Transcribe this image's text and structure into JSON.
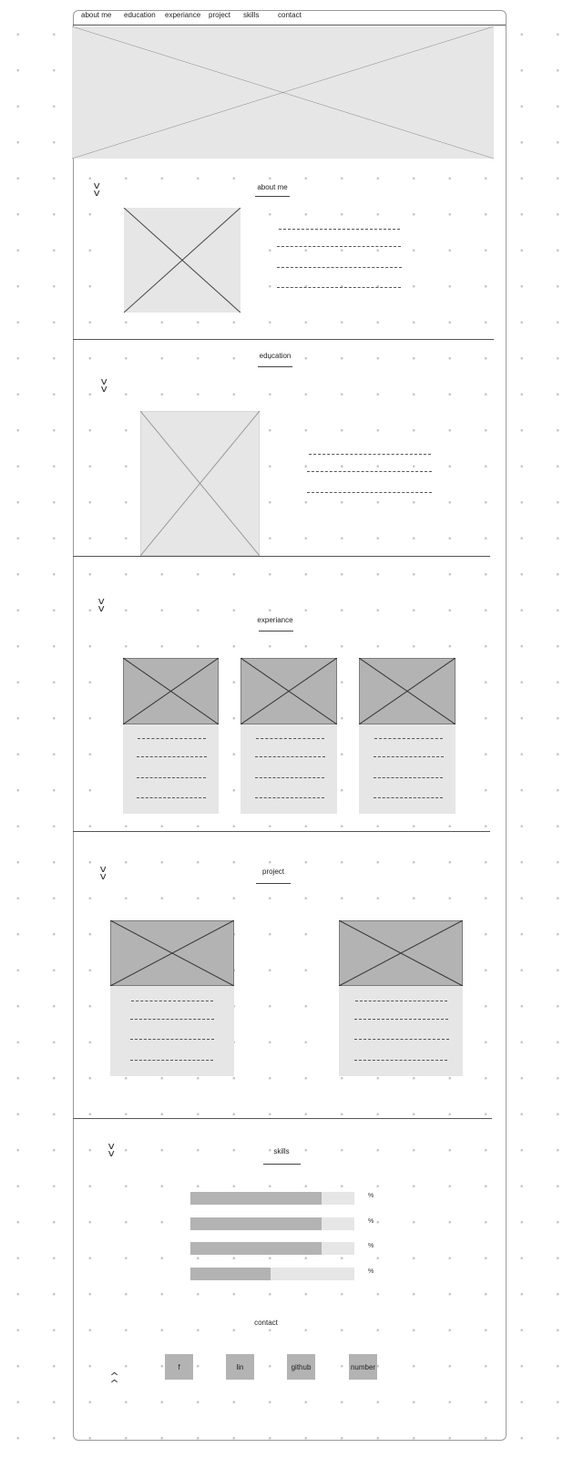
{
  "nav": {
    "items": [
      {
        "id": "about",
        "label": "about me"
      },
      {
        "id": "education",
        "label": "education"
      },
      {
        "id": "experience",
        "label": "experiance"
      },
      {
        "id": "project",
        "label": "project"
      },
      {
        "id": "skills",
        "label": "skills"
      },
      {
        "id": "contact",
        "label": "contact"
      }
    ]
  },
  "sections": {
    "about": {
      "title": "about me",
      "expand_icon": "double-chevron-down-icon"
    },
    "education": {
      "title": "education",
      "expand_icon": "double-chevron-down-icon"
    },
    "experience": {
      "title": "experiance",
      "expand_icon": "double-chevron-down-icon"
    },
    "project": {
      "title": "project",
      "expand_icon": "double-chevron-down-icon"
    },
    "skills": {
      "title": "skills",
      "expand_icon": "double-chevron-down-icon"
    },
    "contact": {
      "title": "contact",
      "back_to_top_icon": "double-chevron-up-icon"
    }
  },
  "skills": {
    "items": [
      {
        "level": 0.8,
        "unit": "%"
      },
      {
        "level": 0.8,
        "unit": "%"
      },
      {
        "level": 0.8,
        "unit": "%"
      },
      {
        "level": 0.49,
        "unit": "%"
      }
    ]
  },
  "contact": {
    "buttons": [
      {
        "id": "facebook",
        "label": "f"
      },
      {
        "id": "linkedin",
        "label": "lin"
      },
      {
        "id": "github",
        "label": "github"
      },
      {
        "id": "number",
        "label": "number"
      }
    ]
  },
  "colors": {
    "placeholder_light": "#e6e6e6",
    "placeholder_dark": "#b3b3b3",
    "frame_border": "#9a9a9a",
    "grid_dot": "#c8c8c8"
  }
}
